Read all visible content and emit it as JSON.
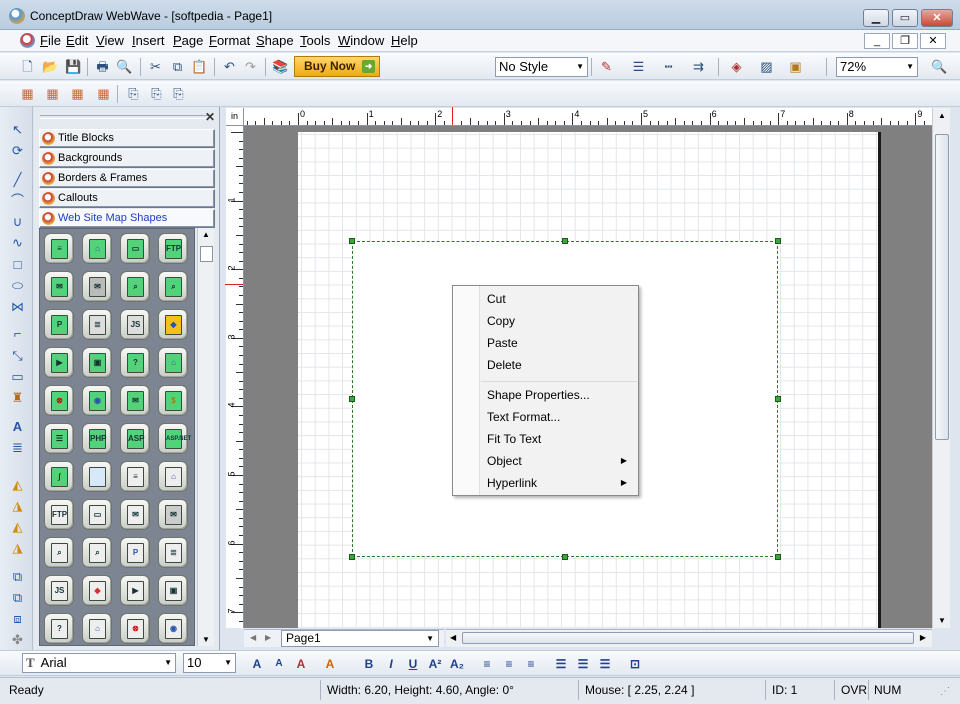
{
  "window": {
    "title": "ConceptDraw WebWave - [softpedia - Page1]",
    "caption_buttons": [
      "minimize",
      "maximize",
      "close"
    ]
  },
  "menubar": {
    "items": [
      "File",
      "Edit",
      "View",
      "Insert",
      "Page",
      "Format",
      "Shape",
      "Tools",
      "Window",
      "Help"
    ]
  },
  "toolbar": {
    "buy_now_label": "Buy Now",
    "style_value": "No Style",
    "zoom_value": "72%"
  },
  "library": {
    "tabs": [
      "Title Blocks",
      "Backgrounds",
      "Borders & Frames",
      "Callouts",
      "Web Site Map Shapes"
    ],
    "active_tab": "Web Site Map Shapes",
    "shape_labels": [
      "FTP",
      "JS",
      "PHP",
      "ASP",
      "ASP.NET",
      "FTP",
      "P",
      "JS",
      "P"
    ]
  },
  "ruler": {
    "unit": "in",
    "h_labels": [
      "0",
      "1",
      "2",
      "3",
      "4",
      "5",
      "6",
      "7",
      "8",
      "9"
    ],
    "v_labels": [
      "1",
      "2",
      "3",
      "4",
      "5",
      "6",
      "7"
    ]
  },
  "context_menu": {
    "group1": [
      "Cut",
      "Copy",
      "Paste",
      "Delete"
    ],
    "group2": [
      "Shape Properties...",
      "Text Format...",
      "Fit To Text",
      "Object",
      "Hyperlink"
    ]
  },
  "page_tabs": {
    "current": "Page1"
  },
  "format_bar": {
    "font": "Arial",
    "size": "10"
  },
  "statusbar": {
    "ready": "Ready",
    "dimensions": "Width: 6.20,  Height: 4.60,  Angle: 0°",
    "mouse": "Mouse: [ 2.25, 2.24 ]",
    "id": "ID: 1",
    "ovr": "OVR",
    "num": "NUM"
  }
}
